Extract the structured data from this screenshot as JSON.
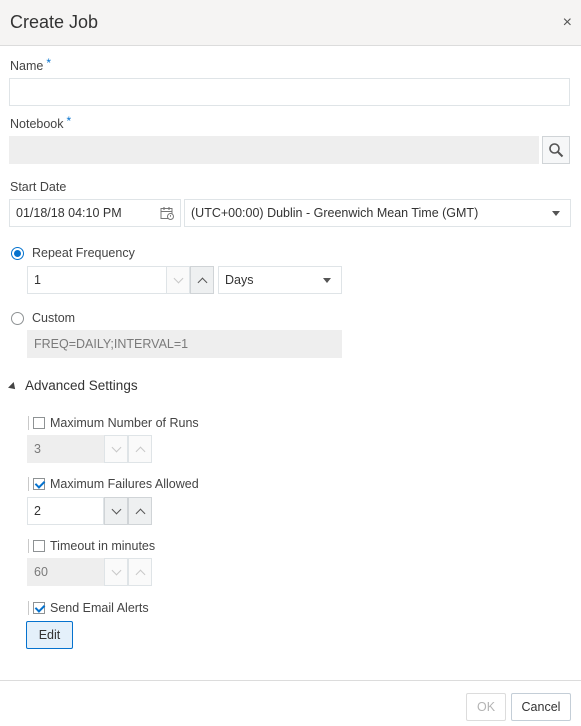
{
  "dialog": {
    "title": "Create Job",
    "close_icon": "close-icon",
    "close_glyph": "×"
  },
  "name": {
    "label": "Name",
    "required_mark": "*",
    "value": ""
  },
  "notebook": {
    "label": "Notebook",
    "required_mark": "*",
    "value": "",
    "search_icon": "search-icon"
  },
  "start_date": {
    "label": "Start Date",
    "date_value": "01/18/18 04:10 PM",
    "calendar_icon": "calendar-icon",
    "timezone_value": "(UTC+00:00) Dublin - Greenwich Mean Time (GMT)"
  },
  "repeat_frequency": {
    "label": "Repeat Frequency",
    "selected": true,
    "value": "1",
    "unit": "Days"
  },
  "custom": {
    "label": "Custom",
    "selected": false,
    "value": "FREQ=DAILY;INTERVAL=1"
  },
  "advanced": {
    "label": "Advanced Settings",
    "expanded": true,
    "max_runs": {
      "label": "Maximum Number of Runs",
      "checked": false,
      "value": "3"
    },
    "max_failures": {
      "label": "Maximum Failures Allowed",
      "checked": true,
      "value": "2"
    },
    "timeout": {
      "label": "Timeout in minutes",
      "checked": false,
      "value": "60"
    },
    "email_alerts": {
      "label": "Send Email Alerts",
      "checked": true,
      "edit_label": "Edit"
    }
  },
  "footer": {
    "ok_label": "OK",
    "cancel_label": "Cancel"
  },
  "colors": {
    "accent": "#0572ce",
    "header_bg": "#f5f4f3",
    "readonly_bg": "#eeeeee"
  }
}
